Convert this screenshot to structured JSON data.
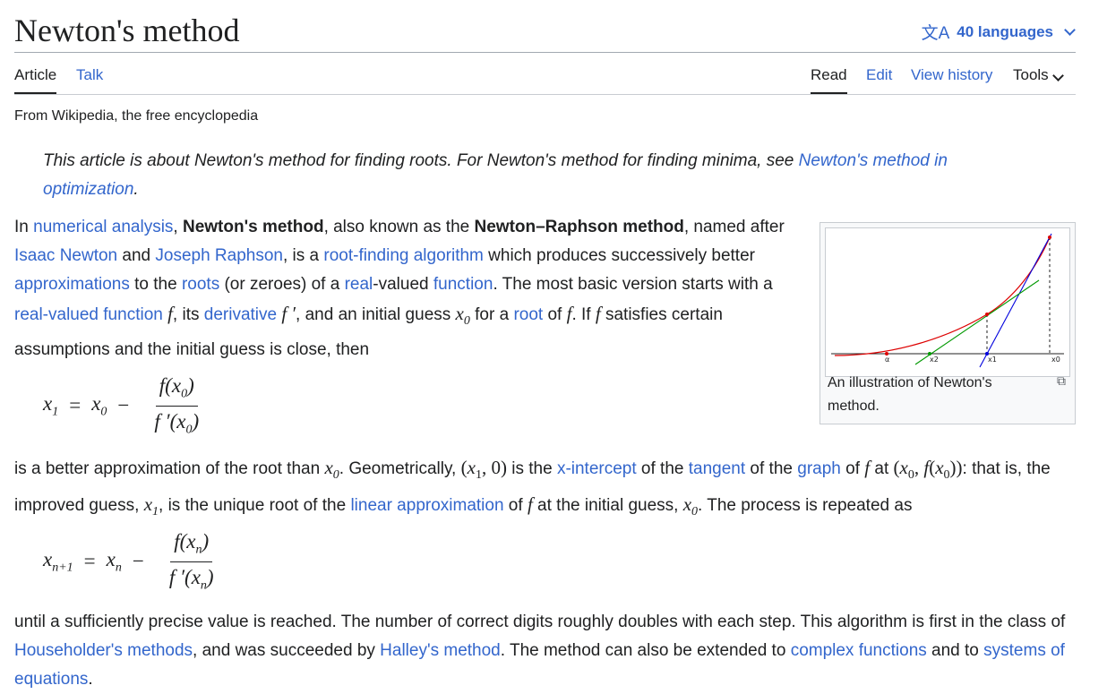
{
  "header": {
    "title": "Newton's method",
    "languages_label": "40 languages",
    "translate_icon": "translate-icon"
  },
  "tabs": {
    "article": "Article",
    "talk": "Talk",
    "read": "Read",
    "edit": "Edit",
    "view_history": "View history",
    "tools": "Tools"
  },
  "tagline": "From Wikipedia, the free encyclopedia",
  "hatnote": {
    "text": "This article is about Newton's method for finding roots. For Newton's method for finding minima, see ",
    "link": "Newton's method in optimization",
    "end": "."
  },
  "intro": {
    "t1": "In ",
    "l_numerical_analysis": "numerical analysis",
    "t2": ", ",
    "b_newtons_method": "Newton's method",
    "t3": ", also known as the ",
    "b_newton_raphson": "Newton–Raphson method",
    "t4": ", named after ",
    "l_isaac_newton": "Isaac Newton",
    "t5": " and ",
    "l_joseph_raphson": "Joseph Raphson",
    "t6": ", is a ",
    "l_root_finding": "root-finding algorithm",
    "t7": " which produces successively better ",
    "l_approximations": "approximations",
    "t8": " to the ",
    "l_roots": "roots",
    "t9": " (or zeroes) of a ",
    "l_real": "real",
    "t10": "-valued ",
    "l_function": "function",
    "t11": ". The most basic version starts with a ",
    "l_real_valued_function": "real-valued function",
    "t12": ", its ",
    "l_derivative": "derivative",
    "t13": ", and an initial guess ",
    "t14": " for a ",
    "l_root": "root",
    "t15": " of ",
    "t16": ". If ",
    "t17": " satisfies certain assumptions and the initial guess is close, then"
  },
  "figure": {
    "caption": "An illustration of Newton's method.",
    "labels": [
      "α",
      "x2",
      "x1",
      "x0"
    ]
  },
  "para2": {
    "t1": "is a better approximation of the root than ",
    "t2": ". Geometrically, ",
    "t3": " is the ",
    "l_x_intercept": "x-intercept",
    "t4": " of the ",
    "l_tangent": "tangent",
    "t5": " of the ",
    "l_graph": "graph",
    "t6": " of ",
    "t7": " at ",
    "t8": ": that is, the improved guess, ",
    "t9": ", is the unique root of the ",
    "l_linear_approximation": "linear approximation",
    "t10": " of ",
    "t11": " at the initial guess, ",
    "t12": ". The process is repeated as"
  },
  "para3": {
    "t1": "until a sufficiently precise value is reached. The number of correct digits roughly doubles with each step. This algorithm is first in the class of ",
    "l_householder": "Householder's methods",
    "t2": ", and was succeeded by ",
    "l_halley": "Halley's method",
    "t3": ". The method can also be extended to ",
    "l_complex_functions": "complex functions",
    "t4": " and to ",
    "l_systems": "systems of equations",
    "t5": "."
  }
}
